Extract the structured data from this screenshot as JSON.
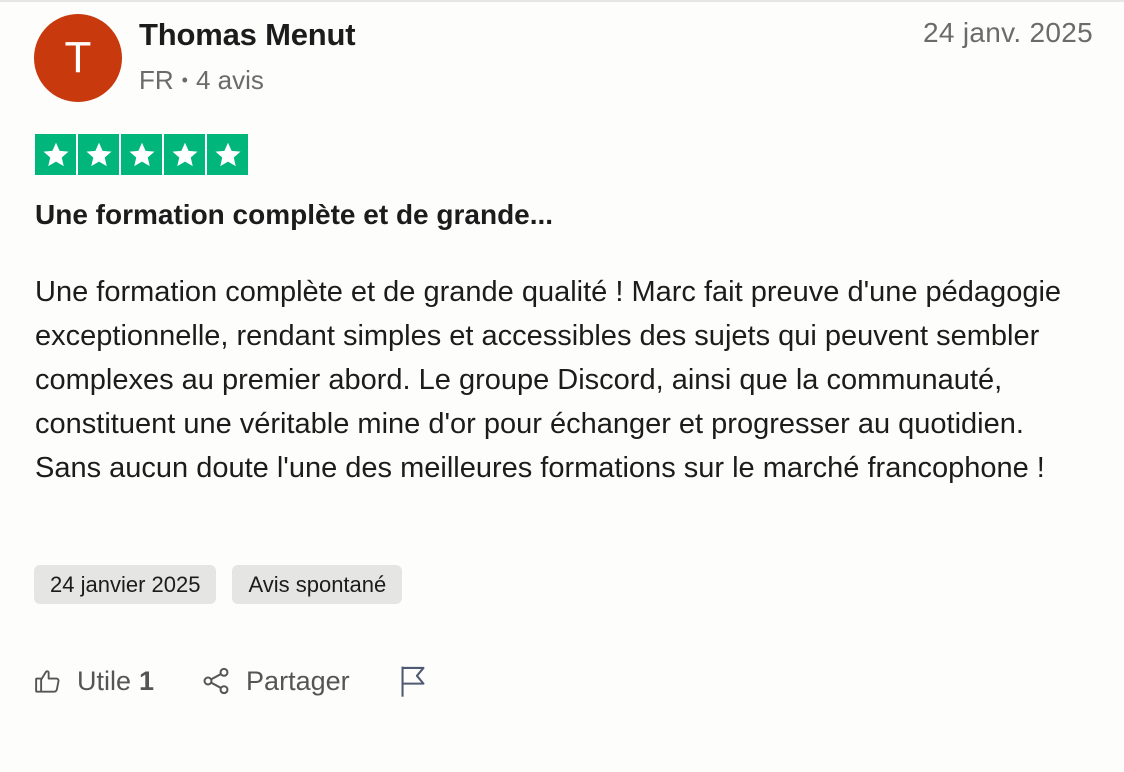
{
  "reviewer": {
    "initial": "T",
    "name": "Thomas Menut",
    "country": "FR",
    "separator": "•",
    "review_count": "4 avis",
    "avatar_color": "#c8390e"
  },
  "review": {
    "date": "24 janv. 2025",
    "rating": 5,
    "rating_max": 5,
    "star_color": "#00b67a",
    "title": "Une formation complète et de grande...",
    "body": "Une formation complète et de grande qualité ! Marc fait preuve d'une pédagogie exceptionnelle, rendant simples et accessibles des sujets qui peuvent sembler complexes au premier abord. Le groupe Discord, ainsi que la communauté, constituent une véritable mine d'or pour échanger et progresser au quotidien. Sans aucun doute l'une des meilleures formations sur le marché francophone !"
  },
  "tags": {
    "experience_date": "24 janvier 2025",
    "review_type": "Avis spontané"
  },
  "actions": {
    "useful_label": "Utile",
    "useful_count": "1",
    "share_label": "Partager",
    "icons": {
      "useful": "thumbs-up-icon",
      "share": "share-icon",
      "report": "flag-icon"
    }
  }
}
